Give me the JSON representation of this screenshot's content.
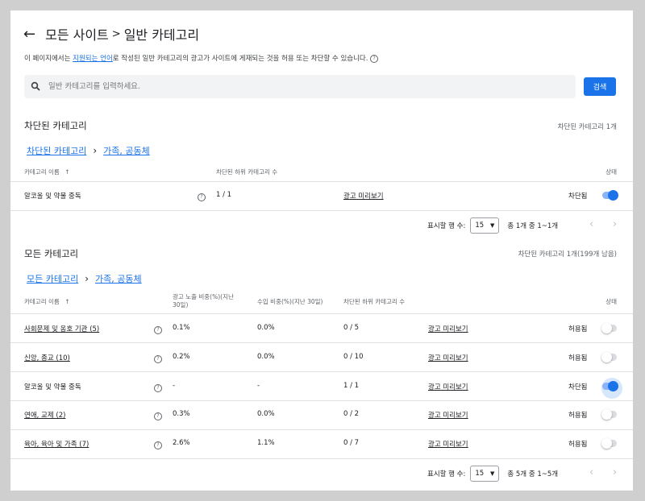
{
  "header": {
    "breadcrumb_root": "모든 사이트",
    "breadcrumb_sep": ">",
    "breadcrumb_current": "일반 카테고리"
  },
  "description": {
    "before": "이 페이지에서는 ",
    "link": "지원되는 언어",
    "after": "로 작성된 일반 카테고리의 광고가 사이트에 게재되는 것을 허용 또는 차단할 수 있습니다."
  },
  "search": {
    "placeholder": "일반 카테고리를 입력하세요.",
    "button_label": "검색"
  },
  "blocked_section": {
    "title": "차단된 카테고리",
    "count_text": "차단된 카테고리 1개",
    "crumb_root": "차단된 카테고리",
    "crumb_current": "가족, 공동체",
    "columns": {
      "name": "카테고리 이름",
      "sub_blocked": "차단된 하위 카테고리 수",
      "status": "상태"
    },
    "rows": [
      {
        "name": "알코올 및 약물 중독",
        "sub_blocked": "1 / 1",
        "preview": "광고 미리보기",
        "status": "차단됨",
        "blocked": true
      }
    ],
    "pager": {
      "rows_label": "표시할 행 수:",
      "rows_value": "15",
      "range_text": "총 1개 중 1~1개"
    }
  },
  "all_section": {
    "title": "모든 카테고리",
    "count_text": "차단된 카테고리 1개(199개 남음)",
    "crumb_root": "모든 카테고리",
    "crumb_current": "가족, 공동체",
    "columns": {
      "name": "카테고리 이름",
      "impr_line1": "광고 노출 비중(%)(지난",
      "impr_line2": "30일)",
      "revenue": "수입 비중(%)(지난 30일)",
      "sub_blocked": "차단된 하위 카테고리 수",
      "status": "상태"
    },
    "rows": [
      {
        "name": "사회문제 및 옹호 기관 (5)",
        "is_link": true,
        "impr": "0.1%",
        "revenue": "0.0%",
        "sub_blocked": "0 / 5",
        "preview": "광고 미리보기",
        "status": "허용됨",
        "blocked": false
      },
      {
        "name": "신앙, 종교 (10)",
        "is_link": true,
        "impr": "0.2%",
        "revenue": "0.0%",
        "sub_blocked": "0 / 10",
        "preview": "광고 미리보기",
        "status": "허용됨",
        "blocked": false
      },
      {
        "name": "알코올 및 약물 중독",
        "is_link": false,
        "impr": "-",
        "revenue": "-",
        "sub_blocked": "1 / 1",
        "preview": "광고 미리보기",
        "status": "차단됨",
        "blocked": true
      },
      {
        "name": "연애, 교제 (2)",
        "is_link": true,
        "impr": "0.3%",
        "revenue": "0.0%",
        "sub_blocked": "0 / 2",
        "preview": "광고 미리보기",
        "status": "허용됨",
        "blocked": false
      },
      {
        "name": "육아, 육아 및 가족 (7)",
        "is_link": true,
        "impr": "2.6%",
        "revenue": "1.1%",
        "sub_blocked": "0 / 7",
        "preview": "광고 미리보기",
        "status": "허용됨",
        "blocked": false
      }
    ],
    "pager": {
      "rows_label": "표시할 행 수:",
      "rows_value": "15",
      "range_text": "총 5개 중 1~5개"
    }
  },
  "icons": {
    "back": "arrow-left-icon",
    "search": "search-icon",
    "help": "help-circle-icon",
    "sort": "arrow-up-icon",
    "dropdown": "caret-down-icon",
    "prev": "chevron-left-icon",
    "next": "chevron-right-icon"
  },
  "colors": {
    "accent": "#1a73e8",
    "toggle_on_track": "#8ab4f8",
    "toggle_off_track": "#dadce0",
    "search_bg": "#f1f3f4"
  }
}
